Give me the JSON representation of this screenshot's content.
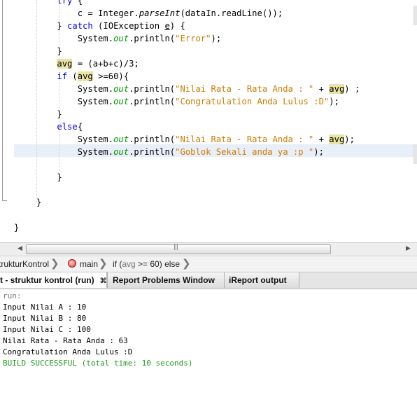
{
  "editor": {
    "lines": [
      {
        "parts": [
          {
            "t": "    "
          },
          {
            "t": "try",
            "c": "kw"
          },
          {
            "t": " {"
          }
        ]
      },
      {
        "parts": [
          {
            "t": "        c = Integer."
          },
          {
            "t": "parseInt",
            "c": "it"
          },
          {
            "t": "(dataIn.readLine());"
          }
        ]
      },
      {
        "parts": [
          {
            "t": "    } "
          },
          {
            "t": "catch",
            "c": "kw"
          },
          {
            "t": " (IOException "
          },
          {
            "t": "e",
            "c": "underline"
          },
          {
            "t": ") {"
          }
        ]
      },
      {
        "parts": [
          {
            "t": "        System."
          },
          {
            "t": "out",
            "c": "fld"
          },
          {
            "t": ".println("
          },
          {
            "t": "\"Error\"",
            "c": "str"
          },
          {
            "t": ");"
          }
        ]
      },
      {
        "parts": [
          {
            "t": "    }"
          }
        ]
      },
      {
        "parts": [
          {
            "t": "    "
          },
          {
            "t": "avg",
            "c": "hl"
          },
          {
            "t": " = (a+b+c)/3;"
          }
        ]
      },
      {
        "parts": [
          {
            "t": "    "
          },
          {
            "t": "if",
            "c": "kw"
          },
          {
            "t": " ("
          },
          {
            "t": "avg",
            "c": "hl"
          },
          {
            "t": " >=60){"
          }
        ]
      },
      {
        "parts": [
          {
            "t": "        System."
          },
          {
            "t": "out",
            "c": "fld"
          },
          {
            "t": ".println("
          },
          {
            "t": "\"Nilai Rata - Rata Anda : \"",
            "c": "str"
          },
          {
            "t": " + "
          },
          {
            "t": "avg",
            "c": "hl"
          },
          {
            "t": ") ;"
          }
        ]
      },
      {
        "parts": [
          {
            "t": "        System."
          },
          {
            "t": "out",
            "c": "fld"
          },
          {
            "t": ".println("
          },
          {
            "t": "\"Congratulation Anda Lulus :D\"",
            "c": "str"
          },
          {
            "t": ");"
          }
        ]
      },
      {
        "parts": [
          {
            "t": "    }"
          }
        ]
      },
      {
        "parts": [
          {
            "t": "    "
          },
          {
            "t": "else",
            "c": "kw"
          },
          {
            "t": "{"
          }
        ]
      },
      {
        "parts": [
          {
            "t": "        System."
          },
          {
            "t": "out",
            "c": "fld"
          },
          {
            "t": ".println("
          },
          {
            "t": "\"Nilai Rata - Rata Anda : \"",
            "c": "str"
          },
          {
            "t": " + "
          },
          {
            "t": "avg",
            "c": "hl"
          },
          {
            "t": ");"
          }
        ]
      },
      {
        "parts": [
          {
            "t": "        System."
          },
          {
            "t": "out",
            "c": "fld"
          },
          {
            "t": ".println("
          },
          {
            "t": "\"Goblok Sekali anda ya :p \"",
            "c": "str"
          },
          {
            "t": ");"
          }
        ]
      },
      {
        "parts": [
          {
            "t": ""
          }
        ]
      },
      {
        "parts": [
          {
            "t": "    }"
          }
        ]
      },
      {
        "parts": [
          {
            "t": ""
          }
        ]
      },
      {
        "parts": [
          {
            "t": "}"
          }
        ]
      },
      {
        "parts": [
          {
            "t": ""
          }
        ]
      },
      {
        "parts": [
          {
            "t": "}"
          }
        ]
      }
    ]
  },
  "hscroll": {
    "left_arrow": "◀",
    "right_arrow": "▶",
    "grip": "|||"
  },
  "breadcrumb": {
    "class_name": "trukturKontrol",
    "method_name": "main",
    "statement_prefix": "if (",
    "statement_var": "avg",
    "statement_suffix": " >= 60) else"
  },
  "tabs": [
    {
      "label": "t - struktur kontrol (run)",
      "close": "⌘"
    },
    {
      "label": "Report Problems Window"
    },
    {
      "label": "iReport output"
    }
  ],
  "output": {
    "lines": [
      {
        "text": "run:",
        "style": "gray"
      },
      {
        "text": "Input Nilai A : 10",
        "style": "normal"
      },
      {
        "text": "Input Nilai B : 80",
        "style": "normal"
      },
      {
        "text": "Input Nilai C : 100",
        "style": "normal"
      },
      {
        "text": "Nilai Rata - Rata Anda : 63",
        "style": "normal"
      },
      {
        "text": "Congratulation Anda Lulus :D",
        "style": "normal"
      },
      {
        "text": "BUILD SUCCESSFUL (total time: 10 seconds)",
        "style": "green"
      }
    ]
  }
}
